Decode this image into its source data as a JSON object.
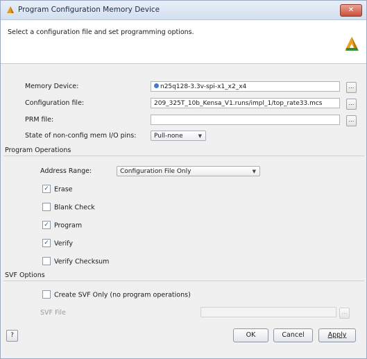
{
  "window": {
    "title": "Program Configuration Memory Device",
    "close_label": "✕"
  },
  "header": {
    "instruction": "Select a configuration file and set programming options."
  },
  "form": {
    "memory_device": {
      "label": "Memory Device:",
      "value": "n25q128-3.3v-spi-x1_x2_x4",
      "browse_label": "…"
    },
    "config_file": {
      "label": "Configuration file:",
      "value": "209_325T_10b_Kensa_V1.runs/impl_1/top_rate33.mcs",
      "browse_label": "…"
    },
    "prm_file": {
      "label": "PRM file:",
      "value": "",
      "browse_label": "…"
    },
    "state_pins": {
      "label": "State of non-config mem I/O pins:",
      "value": "Pull-none"
    }
  },
  "program_operations": {
    "heading": "Program Operations",
    "address_range": {
      "label": "Address Range:",
      "value": "Configuration File Only"
    },
    "options": [
      {
        "label": "Erase",
        "checked": true
      },
      {
        "label": "Blank Check",
        "checked": false
      },
      {
        "label": "Program",
        "checked": true
      },
      {
        "label": "Verify",
        "checked": true
      },
      {
        "label": "Verify Checksum",
        "checked": false
      }
    ]
  },
  "svf_options": {
    "heading": "SVF Options",
    "create_svf": {
      "label": "Create SVF Only (no program operations)",
      "checked": false
    },
    "svf_file": {
      "label": "SVF File",
      "value": "",
      "browse_label": "…"
    }
  },
  "footer": {
    "help_label": "?",
    "ok_label": "OK",
    "cancel_label": "Cancel",
    "apply_label": "Apply"
  }
}
